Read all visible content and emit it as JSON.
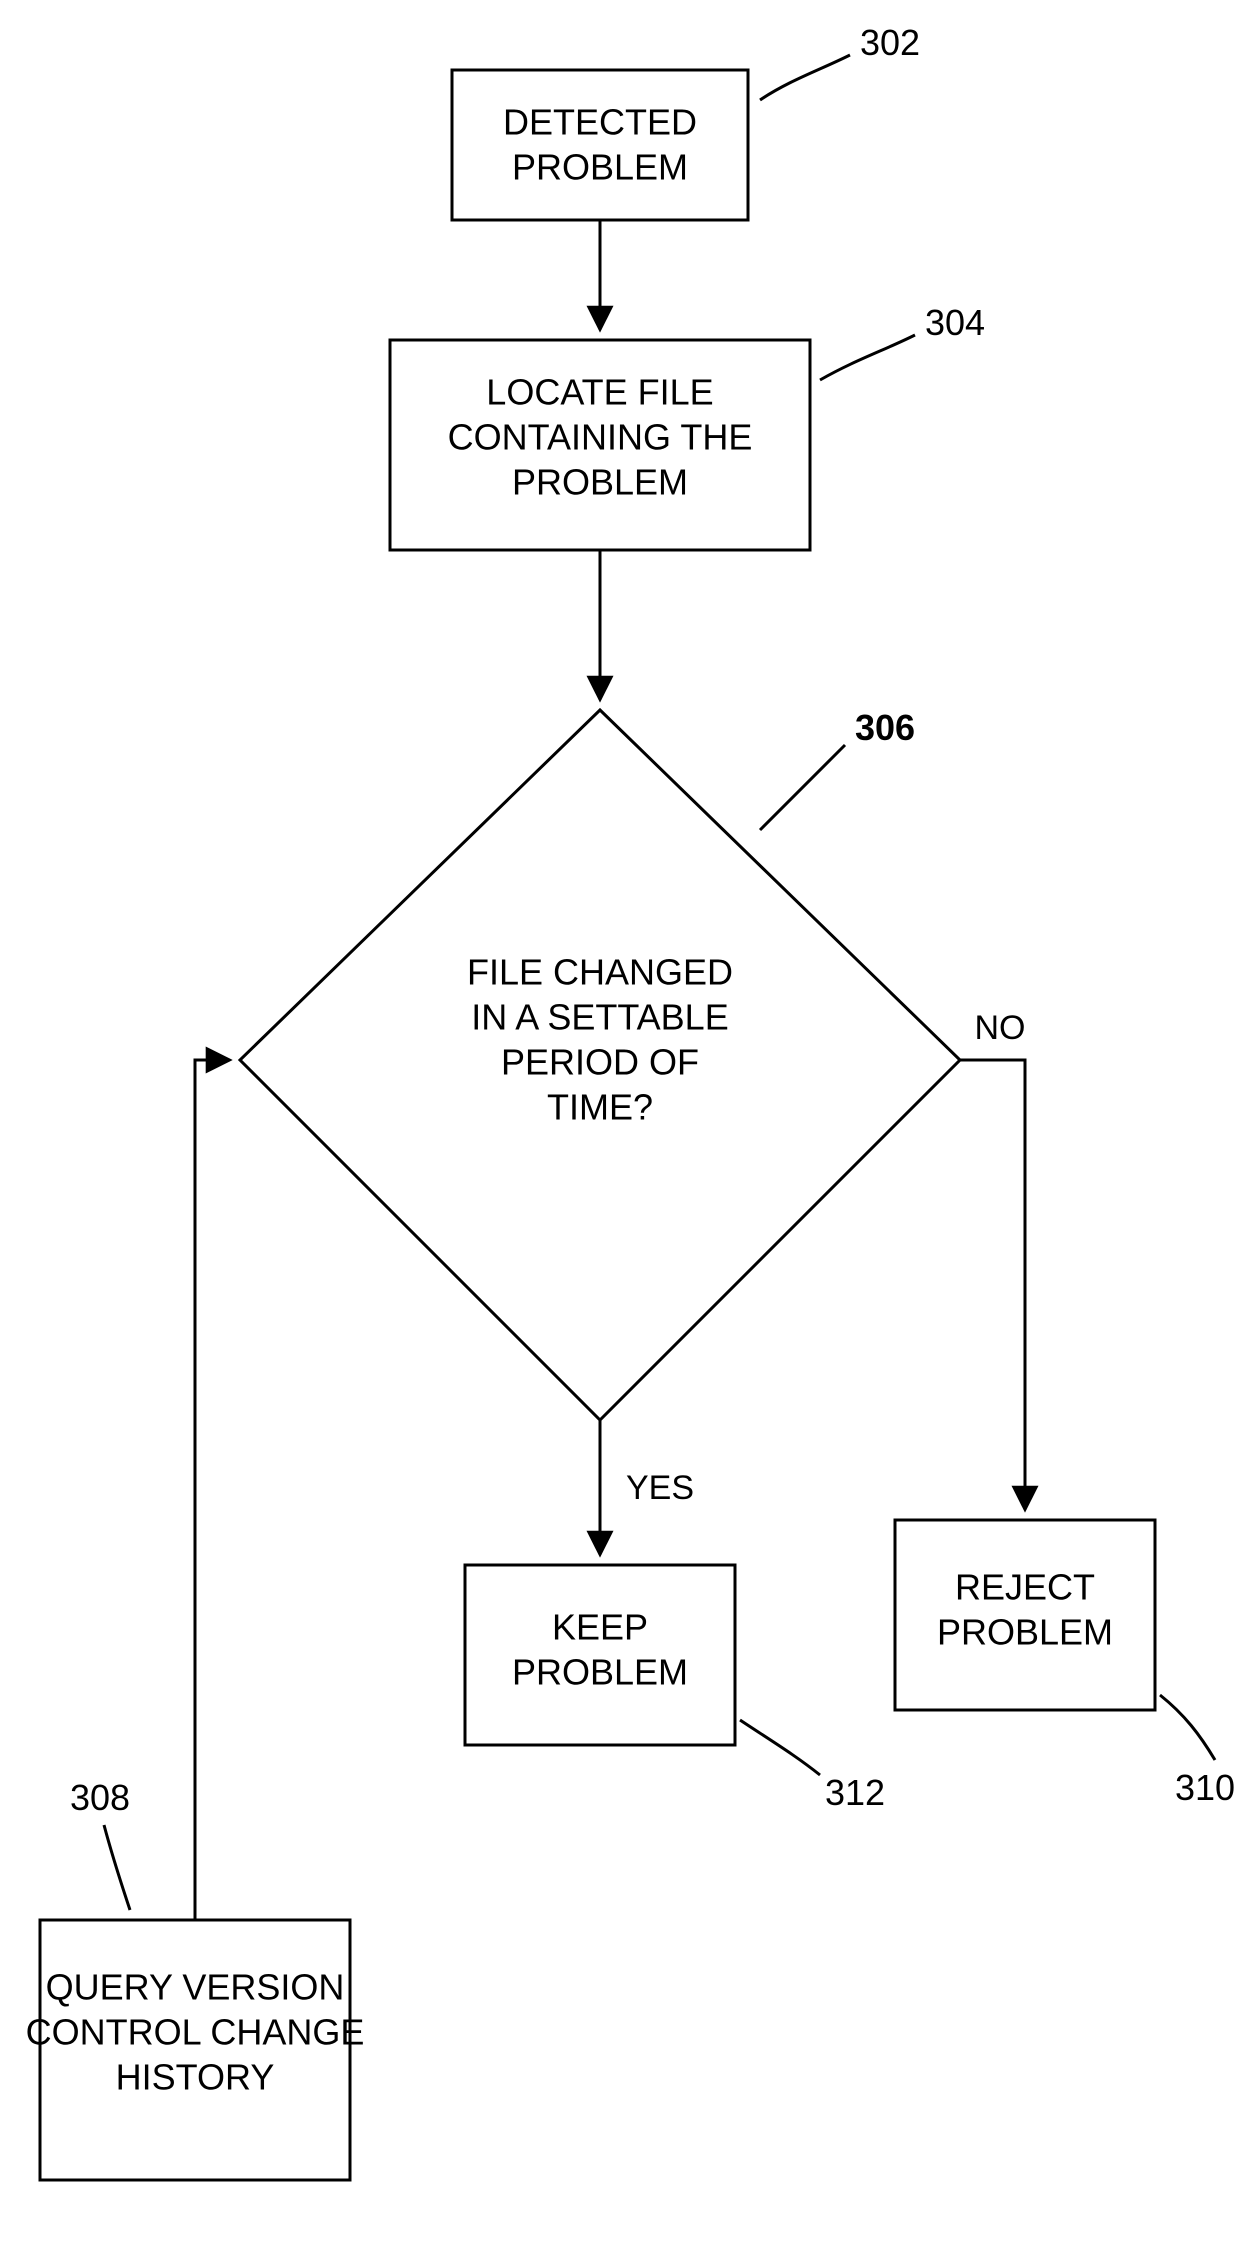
{
  "diagram": {
    "nodes": {
      "detected": {
        "ref": "302",
        "lines": [
          "DETECTED",
          "PROBLEM"
        ]
      },
      "locate": {
        "ref": "304",
        "lines": [
          "LOCATE FILE",
          "CONTAINING THE",
          "PROBLEM"
        ]
      },
      "decision": {
        "ref": "306",
        "lines": [
          "FILE CHANGED",
          "IN A SETTABLE",
          "PERIOD OF",
          "TIME?"
        ]
      },
      "query": {
        "ref": "308",
        "lines": [
          "QUERY VERSION",
          "CONTROL CHANGE",
          "HISTORY"
        ]
      },
      "reject": {
        "ref": "310",
        "lines": [
          "REJECT",
          "PROBLEM"
        ]
      },
      "keep": {
        "ref": "312",
        "lines": [
          "KEEP",
          "PROBLEM"
        ]
      }
    },
    "edges": {
      "no": "NO",
      "yes": "YES"
    }
  }
}
